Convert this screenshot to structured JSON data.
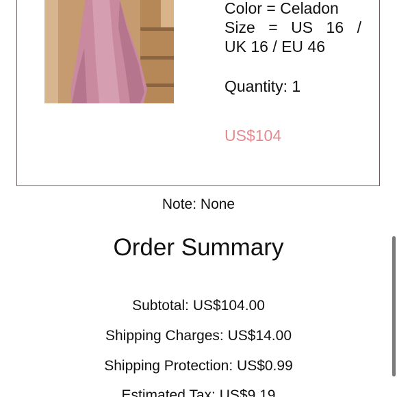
{
  "product": {
    "image_alt": "pink satin gown",
    "color_line": "Color = Celadon",
    "size_line": "Size = US 16 /",
    "size_line2": "UK 16 / EU 46",
    "quantity_line": "Quantity: 1",
    "price": "US$104",
    "price_color": "#e38a8f"
  },
  "note": "Note: None",
  "summary": {
    "title": "Order Summary",
    "subtotal": "Subtotal: US$104.00",
    "shipping": "Shipping Charges: US$14.00",
    "protection": "Shipping Protection: US$0.99",
    "tax": "Estimated Tax: US$9.19"
  }
}
